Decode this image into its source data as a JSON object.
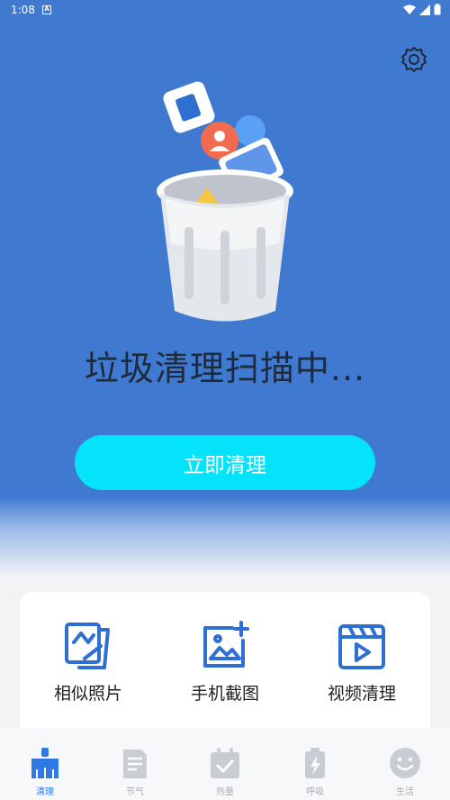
{
  "status_bar": {
    "time": "1:08",
    "notif_letter": "A"
  },
  "hero": {
    "scan_text": "垃圾清理扫描中...",
    "clean_button_label": "立即清理"
  },
  "tools": [
    {
      "label": "相似照片",
      "icon": "similar-photos-icon"
    },
    {
      "label": "手机截图",
      "icon": "add-screenshot-icon"
    },
    {
      "label": "视频清理",
      "icon": "video-clean-icon"
    }
  ],
  "tabs": [
    {
      "label": "清理",
      "icon": "clean-tab-icon",
      "active": true
    },
    {
      "label": "节气",
      "icon": "solar-term-tab-icon",
      "active": false
    },
    {
      "label": "热量",
      "icon": "calorie-tab-icon",
      "active": false
    },
    {
      "label": "呼吸",
      "icon": "breath-tab-icon",
      "active": false
    },
    {
      "label": "生活",
      "icon": "life-tab-icon",
      "active": false
    }
  ],
  "colors": {
    "hero_bg": "#3f79d0",
    "primary_button": "#05e3fb",
    "tool_icon": "#2f6fd1",
    "tab_active": "#2f79e6",
    "tab_inactive": "#c9cdd3"
  }
}
